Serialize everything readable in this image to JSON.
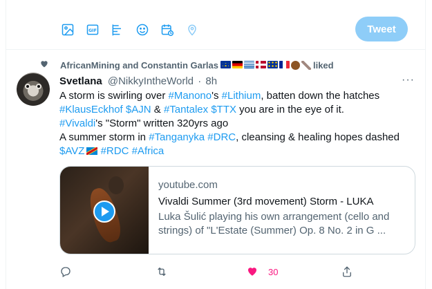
{
  "composer": {
    "tools": [
      {
        "icon": "image-icon"
      },
      {
        "icon": "gif-icon",
        "label": "GIF"
      },
      {
        "icon": "poll-icon"
      },
      {
        "icon": "emoji-icon"
      },
      {
        "icon": "schedule-icon"
      },
      {
        "icon": "location-icon"
      }
    ],
    "tweet_button": "Tweet"
  },
  "tweet": {
    "social_context": {
      "text": "AfricanMining and Constantin Garlas",
      "suffix": "liked",
      "flags": [
        "eu",
        "germany",
        "greece",
        "norway",
        "eu",
        "france",
        "fist",
        "feather"
      ]
    },
    "author": {
      "name": "Svetlana",
      "handle": "@NikkyIntheWorld",
      "separator": "·",
      "time": "8h"
    },
    "more": "···",
    "lines": [
      [
        {
          "t": "A storm is swirling over "
        },
        {
          "t": "#Manono",
          "tag": true
        },
        {
          "t": "'s "
        },
        {
          "t": "#Lithium",
          "tag": true
        },
        {
          "t": ", batten down the hatches"
        }
      ],
      [
        {
          "t": "#KlausEckhof",
          "tag": true
        },
        {
          "t": " "
        },
        {
          "t": "$AJN",
          "tag": true
        },
        {
          "t": " & "
        },
        {
          "t": "#Tantalex",
          "tag": true
        },
        {
          "t": " "
        },
        {
          "t": "$TTX",
          "tag": true
        },
        {
          "t": " you are in the eye of it."
        }
      ],
      [
        {
          "t": "#Vivaldi",
          "tag": true
        },
        {
          "t": "'s \"Storm\" written 320yrs ago"
        }
      ],
      [
        {
          "t": "A summer storm in "
        },
        {
          "t": "#Tanganyka",
          "tag": true
        },
        {
          "t": " "
        },
        {
          "t": "#DRC",
          "tag": true
        },
        {
          "t": ", cleansing & healing hopes dashed"
        }
      ],
      [
        {
          "t": "$AVZ",
          "tag": true
        },
        {
          "t": " ",
          "flag": "drc"
        },
        {
          "t": "#RDC",
          "tag": true
        },
        {
          "t": " "
        },
        {
          "t": "#Africa",
          "tag": true
        }
      ]
    ],
    "card": {
      "domain": "youtube.com",
      "title": "Vivaldi Summer (3rd movement) Storm - LUKA",
      "description": "Luka Šulić playing his own arrangement (cello and strings) of \"L'Estate (Summer) Op. 8 No. 2 in G ..."
    },
    "actions": {
      "reply_icon": "reply-icon",
      "retweet_icon": "retweet-icon",
      "like_icon": "heart-filled-icon",
      "like_count": "30",
      "share_icon": "share-icon"
    },
    "colors": {
      "link": "#1d9bf0",
      "like": "#f91880",
      "muted": "#536471",
      "tweet_button": "#8ecdf8"
    }
  }
}
